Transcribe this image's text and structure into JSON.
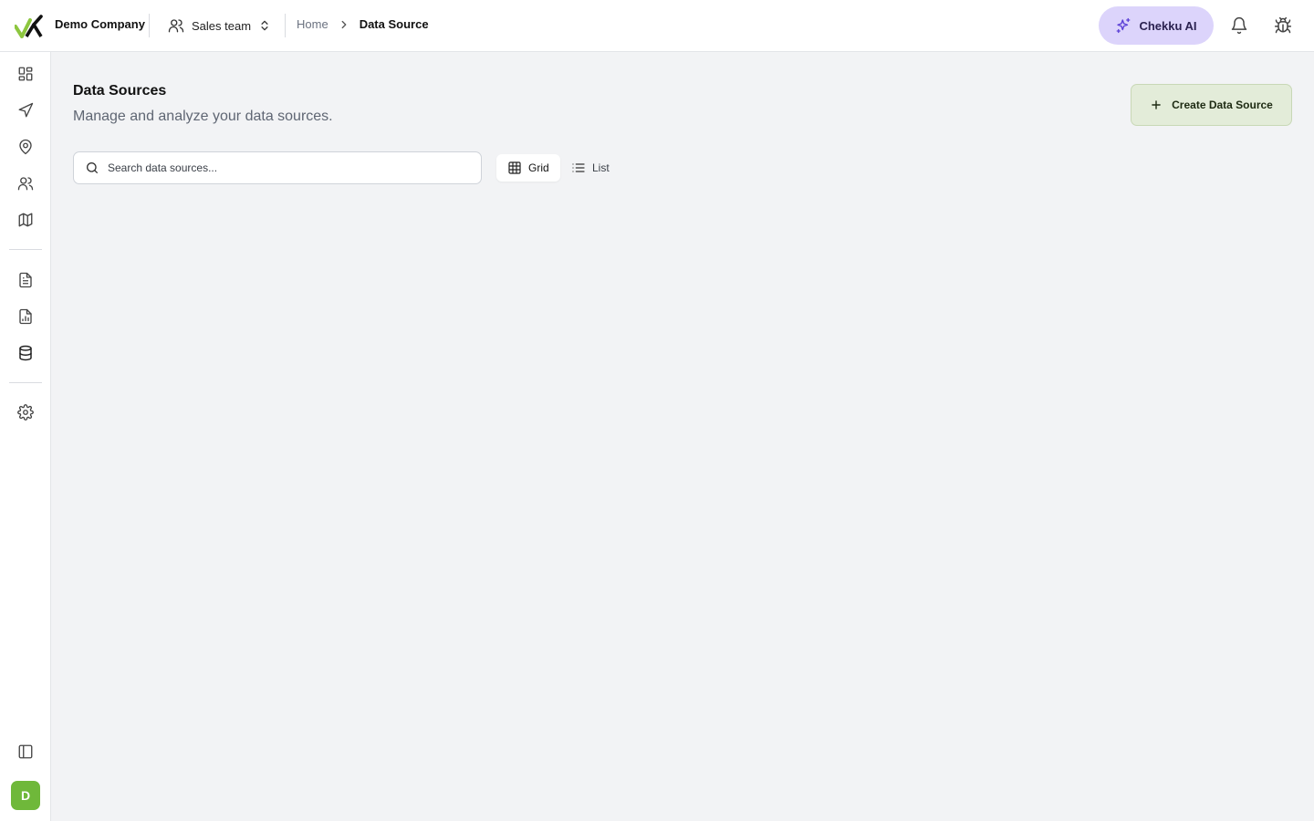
{
  "header": {
    "company_name": "Demo Company",
    "team_name": "Sales team",
    "breadcrumb": [
      {
        "label": "Home"
      },
      {
        "label": "Data Source"
      }
    ],
    "ai_button_label": "Chekku AI",
    "logo_icon": "checkmark-logo",
    "icons": [
      "users-icon",
      "chevron-up-down-icon",
      "chevron-right-icon",
      "sparkles-icon",
      "bell-icon",
      "bug-icon"
    ]
  },
  "sidebar": {
    "items": [
      {
        "icon": "dashboard-icon"
      },
      {
        "icon": "navigation-icon"
      },
      {
        "icon": "map-pin-icon"
      },
      {
        "icon": "users-icon"
      },
      {
        "icon": "map-icon"
      },
      {
        "icon": "document-icon"
      },
      {
        "icon": "report-icon"
      },
      {
        "icon": "database-icon"
      },
      {
        "icon": "settings-icon"
      }
    ],
    "bottom": {
      "toggle_icon": "sidebar-toggle-icon",
      "avatar_initial": "D"
    }
  },
  "main": {
    "title": "Data Sources",
    "subtitle": "Manage and analyze your data sources.",
    "create_button_label": "Create Data Source",
    "search": {
      "placeholder": "Search data sources...",
      "value": ""
    },
    "view_toggle": {
      "options": [
        "Grid",
        "List"
      ],
      "selected": "Grid"
    }
  },
  "colors": {
    "accent_green": "#6fb83a",
    "ai_button_bg": "#dcd4fb",
    "ai_icon": "#5b3fd6",
    "create_button_bg": "#e3ecd9",
    "page_bg": "#f2f3f5"
  }
}
